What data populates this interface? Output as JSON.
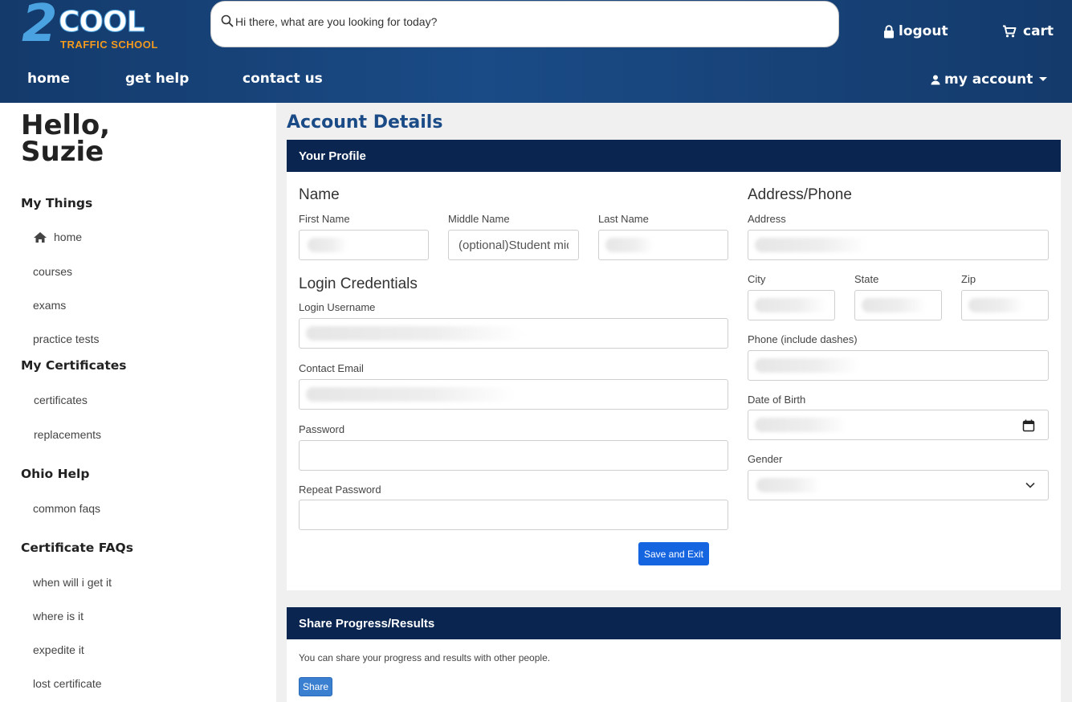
{
  "logo": {
    "mark": "2",
    "word": "COOL",
    "sub": "TRAFFIC SCHOOL"
  },
  "search": {
    "placeholder": "Hi there, what are you looking for today?"
  },
  "header": {
    "logout": "logout",
    "cart": "cart",
    "my_account": "my account"
  },
  "nav": {
    "home": "home",
    "get_help": "get help",
    "contact_us": "contact us"
  },
  "sidebar": {
    "greeting_line1": "Hello,",
    "greeting_line2": "Suzie",
    "my_things": {
      "heading": "My Things",
      "items": [
        "home",
        "courses",
        "exams",
        "practice tests"
      ]
    },
    "my_certificates": {
      "heading": "My Certificates",
      "items": [
        "certificates",
        "replacements"
      ]
    },
    "ohio_help": {
      "heading": "Ohio Help",
      "items": [
        "common faqs"
      ]
    },
    "certificate_faqs": {
      "heading": "Certificate FAQs",
      "items": [
        "when will i get it",
        "where is it",
        "expedite it",
        "lost certificate"
      ]
    }
  },
  "main": {
    "title": "Account Details",
    "profile": {
      "heading": "Your Profile",
      "name_section": "Name",
      "first_name_label": "First Name",
      "middle_name_label": "Middle Name",
      "middle_name_placeholder": "(optional)Student middle name",
      "last_name_label": "Last Name",
      "login_section": "Login Credentials",
      "username_label": "Login Username",
      "email_label": "Contact Email",
      "password_label": "Password",
      "repeat_password_label": "Repeat Password",
      "address_section": "Address/Phone",
      "address_label": "Address",
      "city_label": "City",
      "state_label": "State",
      "zip_label": "Zip",
      "phone_label": "Phone (include dashes)",
      "dob_label": "Date of Birth",
      "gender_label": "Gender",
      "save_button": "Save and Exit"
    },
    "share": {
      "heading": "Share Progress/Results",
      "description": "You can share your progress and results with other people.",
      "button": "Share"
    }
  },
  "icons": [
    "search-icon",
    "lock-icon",
    "cart-icon",
    "user-icon",
    "caret-down-icon",
    "home-icon",
    "calendar-icon",
    "chevron-down-icon"
  ]
}
